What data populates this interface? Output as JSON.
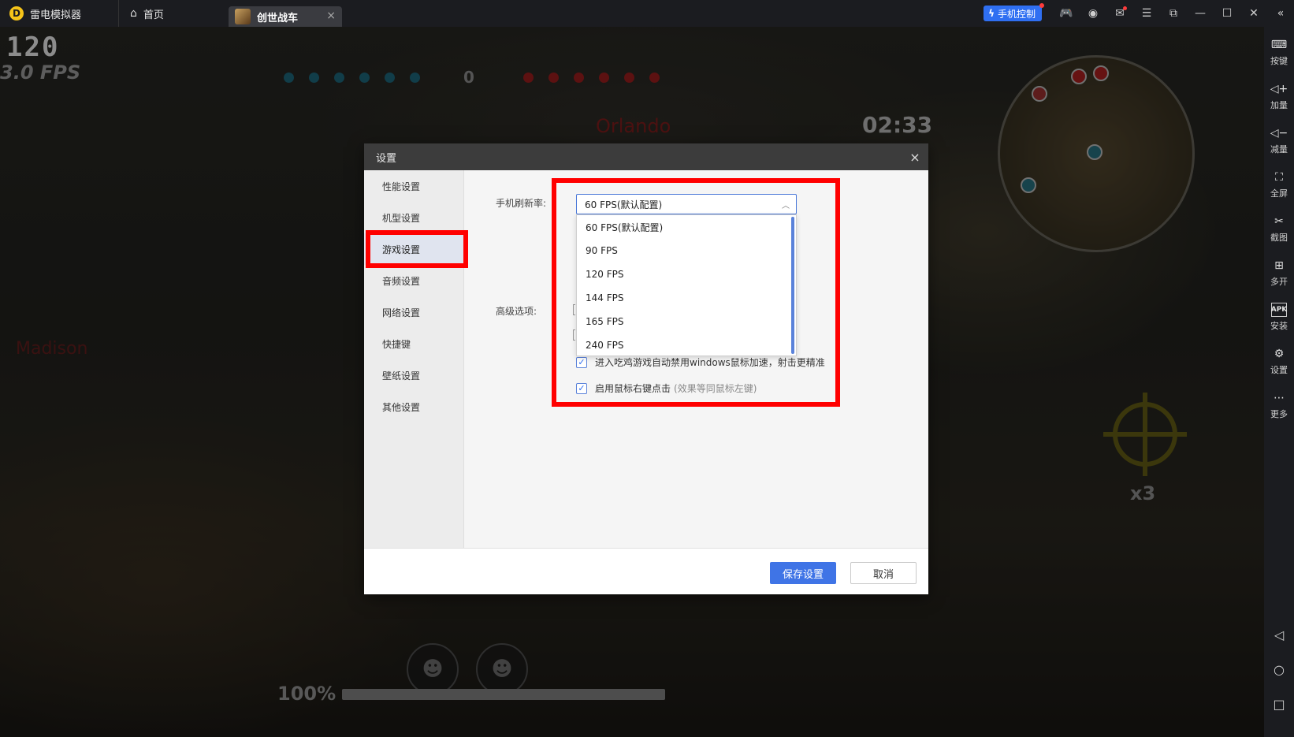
{
  "titlebar": {
    "app_name": "雷电模拟器",
    "logo_letter": "D",
    "tab_home_label": "首页",
    "tab_game_label": "创世战车",
    "tab_close": "×",
    "phone_control_label": "手机控制",
    "window_icons": [
      "gamepad-icon",
      "user-icon",
      "mail-icon",
      "menu-icon",
      "restore-window-icon",
      "minimize-icon",
      "maximize-icon",
      "close-icon",
      "collapse-sidebar-icon"
    ]
  },
  "game": {
    "fps_value": "120",
    "fps_label": "3.0 FPS",
    "score": "0",
    "enemy_name": "Orlando",
    "enemy_name_2": "Madison",
    "timer": "02:33",
    "zoom": "x3",
    "health_text": "100%",
    "health_fraction": 1.0,
    "team_blue_count": 6,
    "team_red_count": 6
  },
  "sidebar": {
    "items": [
      {
        "label": "按键",
        "icon": "keyboard-icon",
        "glyph": "⌨"
      },
      {
        "label": "加量",
        "icon": "volume-up-icon",
        "glyph": "◁+"
      },
      {
        "label": "减量",
        "icon": "volume-down-icon",
        "glyph": "◁−"
      },
      {
        "label": "全屏",
        "icon": "fullscreen-icon",
        "glyph": "⛶"
      },
      {
        "label": "截图",
        "icon": "scissors-icon",
        "glyph": "✂"
      },
      {
        "label": "多开",
        "icon": "multi-instance-icon",
        "glyph": "⊞"
      },
      {
        "label": "安装",
        "icon": "apk-install-icon",
        "glyph": "APK"
      },
      {
        "label": "设置",
        "icon": "gear-icon",
        "glyph": "⚙"
      },
      {
        "label": "更多",
        "icon": "more-icon",
        "glyph": "⋯"
      }
    ],
    "nav": [
      {
        "icon": "back-icon",
        "glyph": "◁"
      },
      {
        "icon": "home-icon",
        "glyph": "○"
      },
      {
        "icon": "recents-icon",
        "glyph": "□"
      }
    ]
  },
  "dialog": {
    "title": "设置",
    "close": "×",
    "nav": [
      "性能设置",
      "机型设置",
      "游戏设置",
      "音频设置",
      "网络设置",
      "快捷键",
      "壁纸设置",
      "其他设置"
    ],
    "active_nav": "游戏设置",
    "refresh_label": "手机刷新率:",
    "selected_value": "60 FPS(默认配置)",
    "options": [
      "60 FPS(默认配置)",
      "90 FPS",
      "120 FPS",
      "144 FPS",
      "165 FPS",
      "240 FPS"
    ],
    "advanced_label": "高级选项:",
    "checkboxes": [
      {
        "label": "进入吃鸡游戏自动禁用windows鼠标加速，射击更精准",
        "note": "",
        "checked": true
      },
      {
        "label": "启用鼠标右键点击",
        "note": "(效果等同鼠标左键)",
        "checked": true
      }
    ],
    "save_label": "保存设置",
    "cancel_label": "取消"
  },
  "colors": {
    "accent": "#3f74e6",
    "highlight": "#ff0000",
    "titlebar_bg": "#1b1c20",
    "dialog_header": "#3c3c3c"
  }
}
